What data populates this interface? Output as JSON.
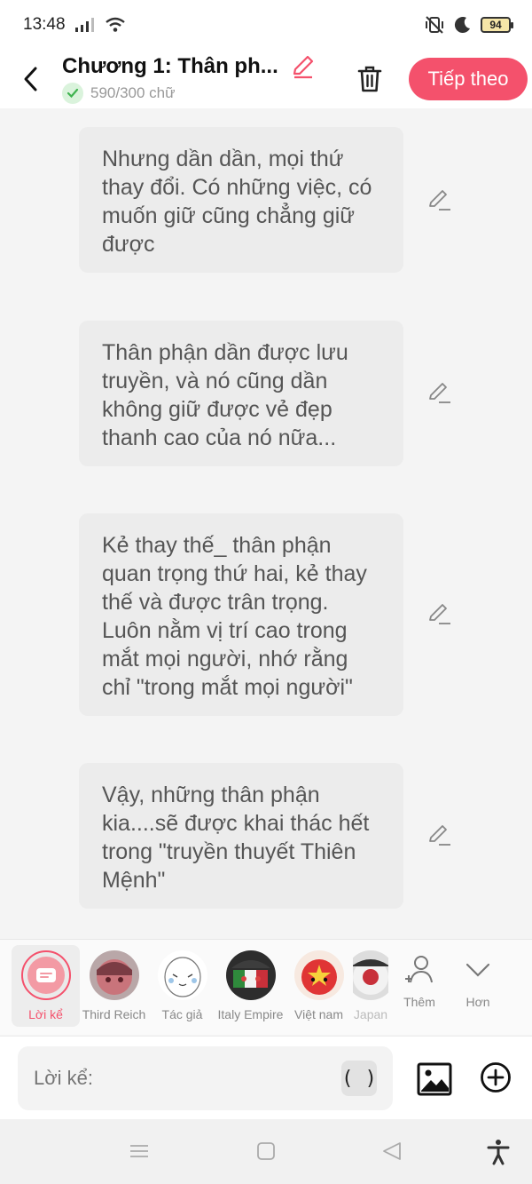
{
  "status_bar": {
    "time": "13:48",
    "battery": "94"
  },
  "header": {
    "chapter_title": "Chương 1: Thân ph...",
    "word_count": "590/300 chữ",
    "next_label": "Tiếp theo"
  },
  "messages": [
    {
      "text": "Nhưng dần dần, mọi thứ thay đổi. Có những việc, có muốn giữ cũng chẳng giữ được"
    },
    {
      "text": "Thân phận dần được lưu truyền, và nó cũng dần không giữ được vẻ đẹp thanh cao của nó nữa..."
    },
    {
      "text": "Kẻ thay thế_ thân phận quan trọng thứ hai, kẻ thay thế và được trân trọng. Luôn nằm vị trí cao trong mắt mọi người, nhớ rằng chỉ \"trong mắt mọi người\""
    },
    {
      "text": "Vậy, những thân phận kia....sẽ được khai thác hết trong \"truyền thuyết Thiên Mệnh\""
    }
  ],
  "characters": [
    {
      "name": "Lời kể"
    },
    {
      "name": "Third Reich"
    },
    {
      "name": "Tác giả"
    },
    {
      "name": "Italy Empire"
    },
    {
      "name": "Việt nam"
    },
    {
      "name": "Japan"
    }
  ],
  "side_actions": {
    "more_label": "Thêm",
    "expand_label": "Hơn"
  },
  "input": {
    "placeholder": "Lời kể:",
    "bracket_label": "( )"
  },
  "colors": {
    "accent": "#f4516c",
    "bubble": "#ececec",
    "background": "#f4f4f4"
  }
}
